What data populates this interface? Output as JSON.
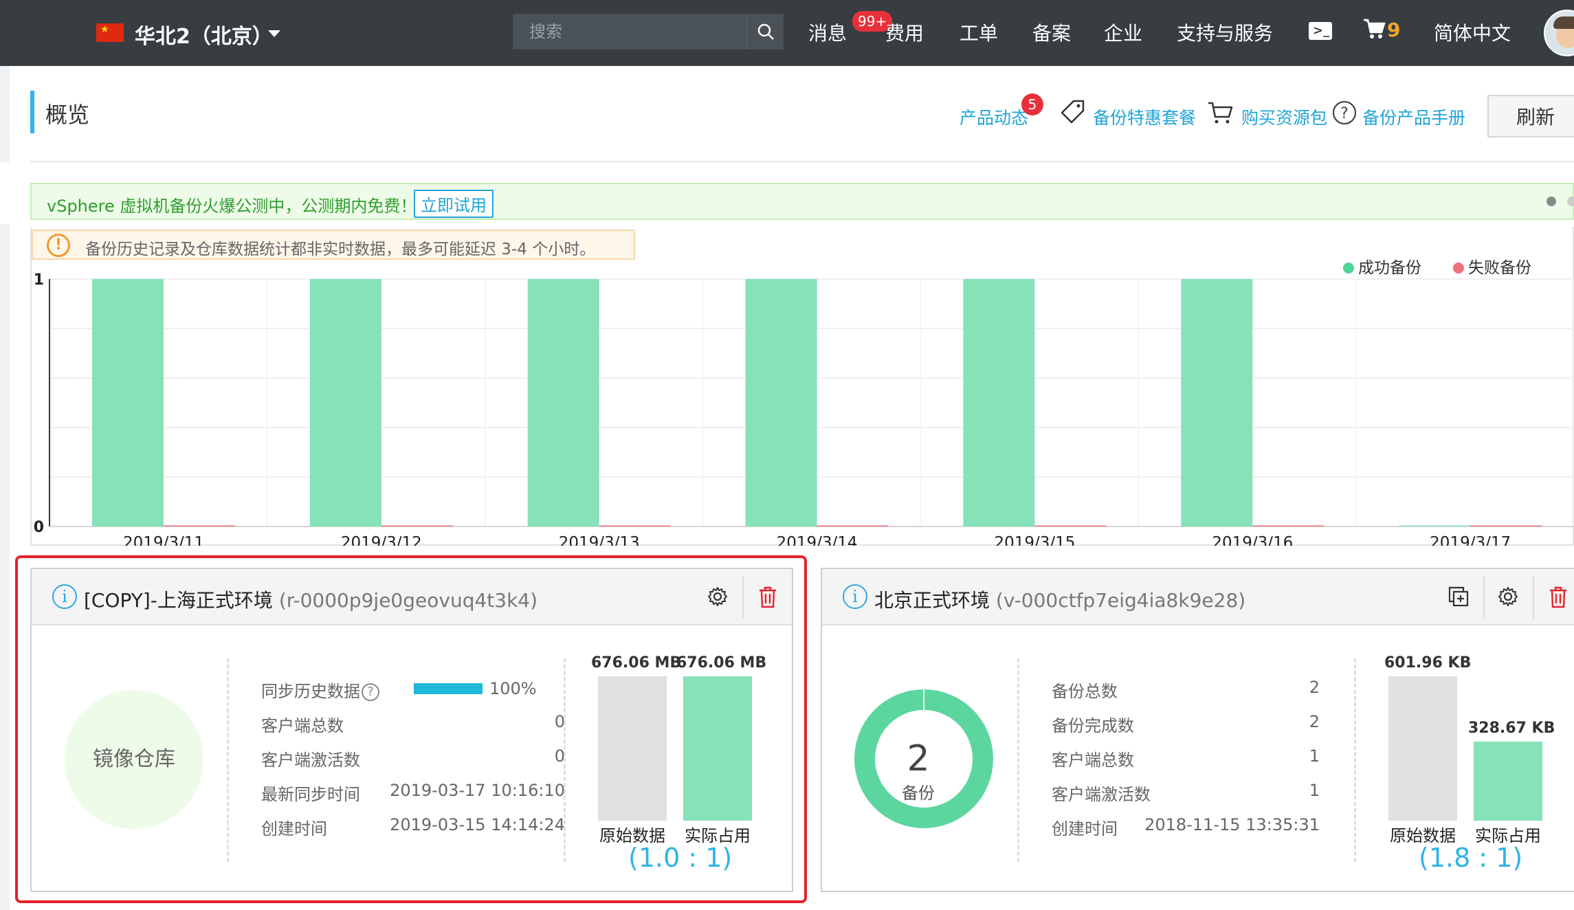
{
  "topbar": {
    "region": "华北2（北京）",
    "search_placeholder": "搜索",
    "nav": {
      "messages": "消息",
      "messages_badge": "99+",
      "billing": "费用",
      "tickets": "工单",
      "icp": "备案",
      "enterprise": "企业",
      "support": "支持与服务",
      "cart_count": "9",
      "language": "简体中文"
    }
  },
  "header": {
    "title": "概览",
    "links": {
      "product_news": "产品动态",
      "product_news_badge": "5",
      "backup_deals": "备份特惠套餐",
      "buy_package": "购买资源包",
      "manual": "备份产品手册"
    },
    "refresh_label": "刷新"
  },
  "promo": {
    "text": "vSphere 虚拟机备份火爆公测中，公测期内免费！",
    "button": "立即试用"
  },
  "notice": {
    "icon": "!",
    "text": "备份历史记录及仓库数据统计都非实时数据，最多可能延迟 3-4 个小时。"
  },
  "chart_data": {
    "type": "bar",
    "categories": [
      "2019/3/11",
      "2019/3/12",
      "2019/3/13",
      "2019/3/14",
      "2019/3/15",
      "2019/3/16",
      "2019/3/17"
    ],
    "series": [
      {
        "name": "成功备份",
        "values": [
          1,
          1,
          1,
          1,
          1,
          1,
          0
        ],
        "color": "#86e2b8"
      },
      {
        "name": "失败备份",
        "values": [
          0,
          0,
          0,
          0,
          0,
          0,
          0
        ],
        "color": "#f0707c"
      }
    ],
    "ylim": [
      0,
      1
    ],
    "yticks": [
      "0",
      "1"
    ],
    "grid": true,
    "legend_position": "top-right"
  },
  "cards": {
    "mirror": {
      "info_icon": "i",
      "title": "[COPY]-上海正式环境",
      "id": "(r-0000p9je0geovuq4t3k4)",
      "type_label": "镜像仓库",
      "stats": [
        {
          "label": "同步历史数据",
          "value": "100%",
          "progress": 1.0
        },
        {
          "label": "客户端总数",
          "value": "0"
        },
        {
          "label": "客户端激活数",
          "value": "0"
        },
        {
          "label": "最新同步时间",
          "value": "2019-03-17 10:16:10"
        },
        {
          "label": "创建时间",
          "value": "2019-03-15 14:14:24"
        }
      ],
      "bars": {
        "original_value": "676.06 MB",
        "actual_value": "676.06 MB",
        "original_ratio": 1.0,
        "actual_ratio": 1.0,
        "original_label": "原始数据",
        "actual_label": "实际占用",
        "ratio": "(1.0 : 1)"
      }
    },
    "beijing": {
      "info_icon": "i",
      "title": "北京正式环境",
      "id": "(v-000ctfp7eig4ia8k9e28)",
      "donut_value": "2",
      "donut_unit": "备份",
      "donut_fill": 1.0,
      "stats": [
        {
          "label": "备份总数",
          "value": "2"
        },
        {
          "label": "备份完成数",
          "value": "2"
        },
        {
          "label": "客户端总数",
          "value": "1"
        },
        {
          "label": "客户端激活数",
          "value": "1"
        },
        {
          "label": "创建时间",
          "value": "2018-11-15 13:35:31"
        }
      ],
      "bars": {
        "original_value": "601.96 KB",
        "actual_value": "328.67 KB",
        "original_ratio": 1.0,
        "actual_ratio": 0.546,
        "original_label": "原始数据",
        "actual_label": "实际占用",
        "ratio": "(1.8 : 1)"
      }
    }
  },
  "icons": {
    "search": "search-icon",
    "terminal": "terminal-icon",
    "cart": "cart-icon",
    "tag": "tag-icon",
    "help": "question-icon",
    "settings": "gear-icon",
    "delete": "trash-icon",
    "copy": "copy-icon"
  }
}
